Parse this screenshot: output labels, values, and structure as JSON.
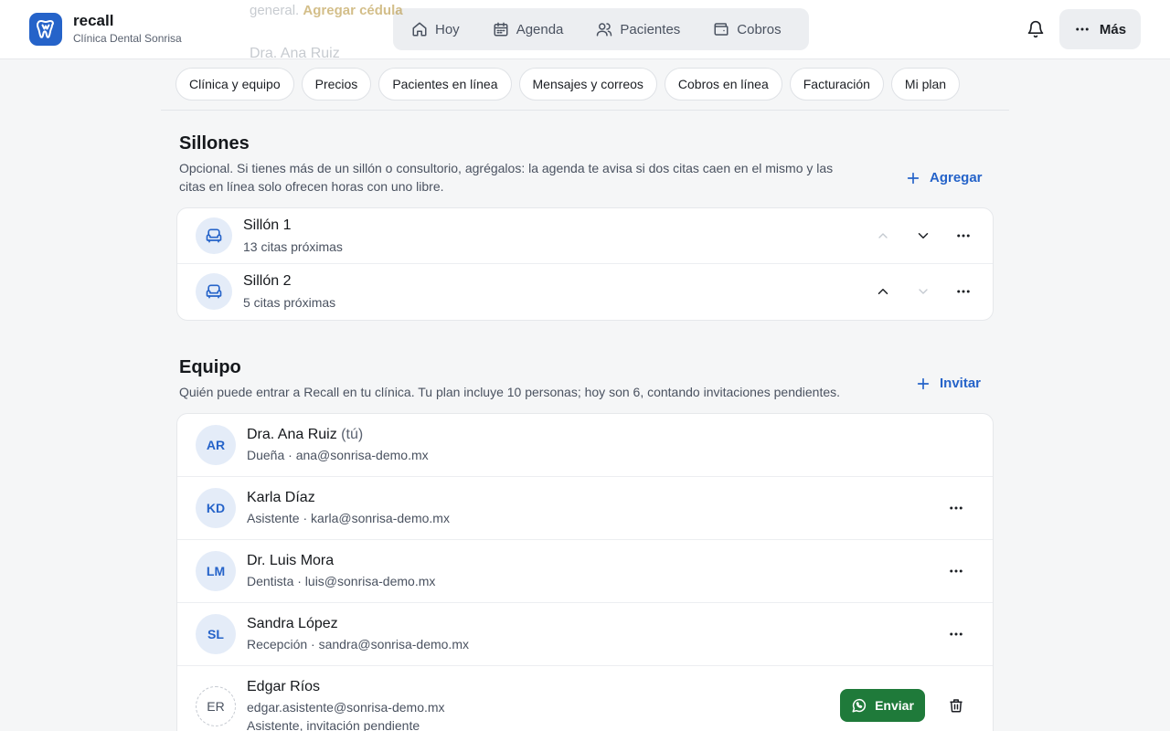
{
  "header": {
    "brand_name": "recall",
    "brand_sub": "Clínica Dental Sonrisa",
    "nav": [
      {
        "label": "Hoy",
        "icon": "home-icon"
      },
      {
        "label": "Agenda",
        "icon": "calendar-icon"
      },
      {
        "label": "Pacientes",
        "icon": "users-icon"
      },
      {
        "label": "Cobros",
        "icon": "wallet-icon"
      }
    ],
    "more_label": "Más"
  },
  "ghost": {
    "line1_prefix": "general.",
    "line1_link": "Agregar cédula",
    "line2": "Dra. Ana Ruiz"
  },
  "tabs": [
    "Clínica y equipo",
    "Precios",
    "Pacientes en línea",
    "Mensajes y correos",
    "Cobros en línea",
    "Facturación",
    "Mi plan"
  ],
  "chairs": {
    "title": "Sillones",
    "description_line1": "Opcional. Si tienes más de un sillón o consultorio, agrégalos: la agenda te avisa si dos citas caen en el mismo y las",
    "description_line2": "citas en línea solo ofrecen horas con uno libre.",
    "add_label": "Agregar",
    "items": [
      {
        "name": "Sillón 1",
        "sub": "13 citas próximas"
      },
      {
        "name": "Sillón 2",
        "sub": "5 citas próximas"
      }
    ]
  },
  "team": {
    "title": "Equipo",
    "description": "Quién puede entrar a Recall en tu clínica. Tu plan incluye 10 personas; hoy son 6, contando invitaciones pendientes.",
    "invite_label": "Invitar",
    "members": [
      {
        "initials": "AR",
        "name": "Dra. Ana Ruiz",
        "you": "(tú)",
        "sub": "Dueña · ana@sonrisa-demo.mx"
      },
      {
        "initials": "KD",
        "name": "Karla Díaz",
        "sub": "Asistente · karla@sonrisa-demo.mx"
      },
      {
        "initials": "LM",
        "name": "Dr. Luis Mora",
        "sub": "Dentista · luis@sonrisa-demo.mx"
      },
      {
        "initials": "SL",
        "name": "Sandra López",
        "sub": "Recepción · sandra@sonrisa-demo.mx"
      },
      {
        "initials": "ER",
        "name": "Edgar Ríos",
        "sub": "edgar.asistente@sonrisa-demo.mx",
        "sub2": "Asistente, invitación pendiente"
      }
    ],
    "send_label": "Enviar"
  },
  "colors": {
    "accent": "#2563c9",
    "send_green": "#1f7a3a",
    "page_bg": "#f5f6f7"
  }
}
